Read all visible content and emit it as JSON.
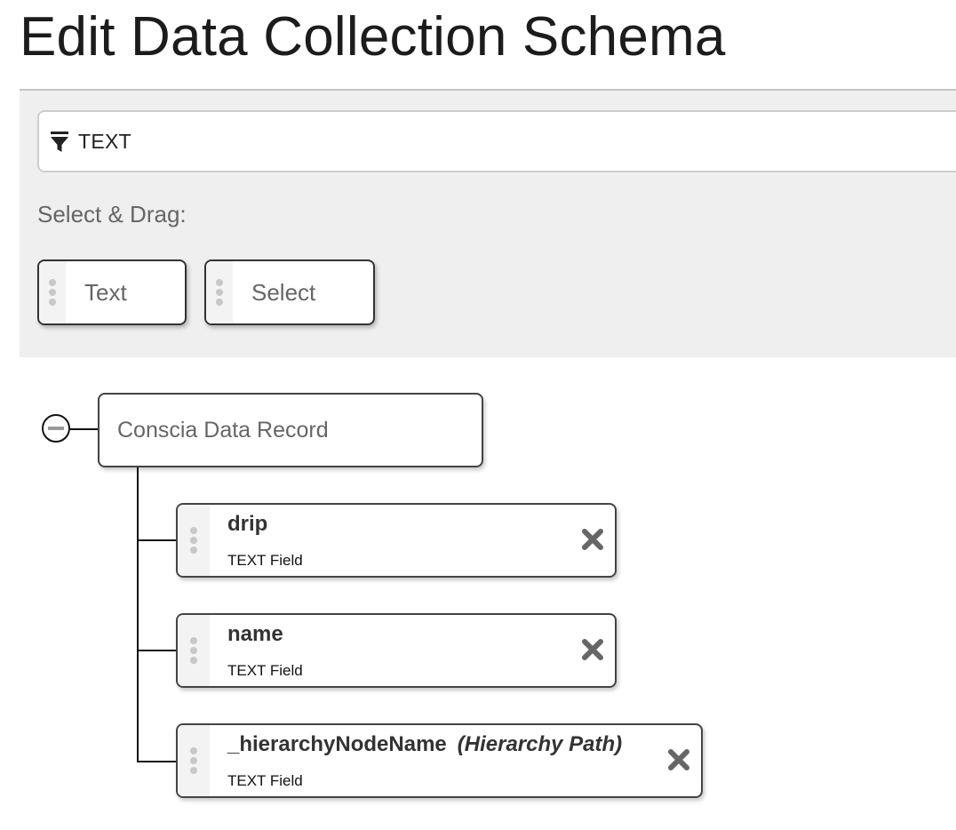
{
  "page": {
    "title": "Edit Data Collection Schema"
  },
  "palette": {
    "filter": {
      "icon": "filter-icon",
      "value": "TEXT"
    },
    "label": "Select & Drag:",
    "chips": [
      {
        "label": "Text",
        "icon": "drag-handle-icon"
      },
      {
        "label": "Select",
        "icon": "drag-handle-icon"
      }
    ]
  },
  "tree": {
    "root": {
      "label": "Conscia Data Record",
      "toggle_icon": "collapse-minus-icon"
    },
    "fields": [
      {
        "name": "drip",
        "qualifier": "",
        "type": "TEXT Field",
        "remove_icon": "close-icon"
      },
      {
        "name": "name",
        "qualifier": "",
        "type": "TEXT Field",
        "remove_icon": "close-icon"
      },
      {
        "name": "_hierarchyNodeName",
        "qualifier": "(Hierarchy Path)",
        "type": "TEXT Field",
        "remove_icon": "close-icon"
      }
    ]
  }
}
